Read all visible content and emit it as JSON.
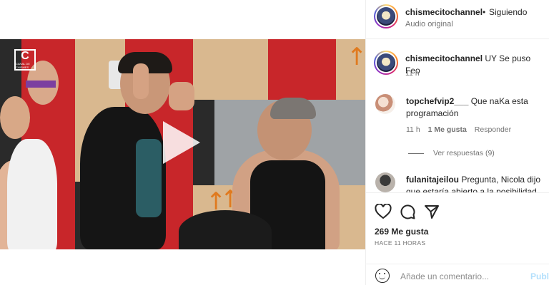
{
  "post_header": {
    "username": "chismecitochannel",
    "separator": "•",
    "follow_status": "Siguiendo",
    "audio": "Audio original"
  },
  "media": {
    "channel_logo_letter": "C",
    "channel_logo_sub": "CANAL DE CHISMES",
    "play_icon": "play-icon",
    "mute_icon": "speaker-icon"
  },
  "caption": {
    "username": "chismecitochannel",
    "text": "UY Se puso Feo",
    "age": "11 h"
  },
  "comments": [
    {
      "username": "topchefvip2___",
      "text": "Que naKa esta programación",
      "age": "11 h",
      "likes": "1 Me gusta",
      "reply": "Responder",
      "view_replies": "Ver respuestas (9)"
    },
    {
      "username": "fulanitajeilou",
      "text": "Pregunta, Nicola dijo que estaría abierto a la posibilidad"
    }
  ],
  "actions": {
    "like_icon": "heart-icon",
    "comment_icon": "comment-icon",
    "share_icon": "send-icon",
    "likes_count": "269 Me gusta",
    "timestamp": "HACE 11 HORAS"
  },
  "add_comment": {
    "emoji_icon": "emoji-icon",
    "placeholder": "Añade un comentario...",
    "publish": "Publi"
  },
  "colors": {
    "text": "#262626",
    "muted": "#737373",
    "publish_disabled": "#b2dffc",
    "divider": "#efefef"
  }
}
